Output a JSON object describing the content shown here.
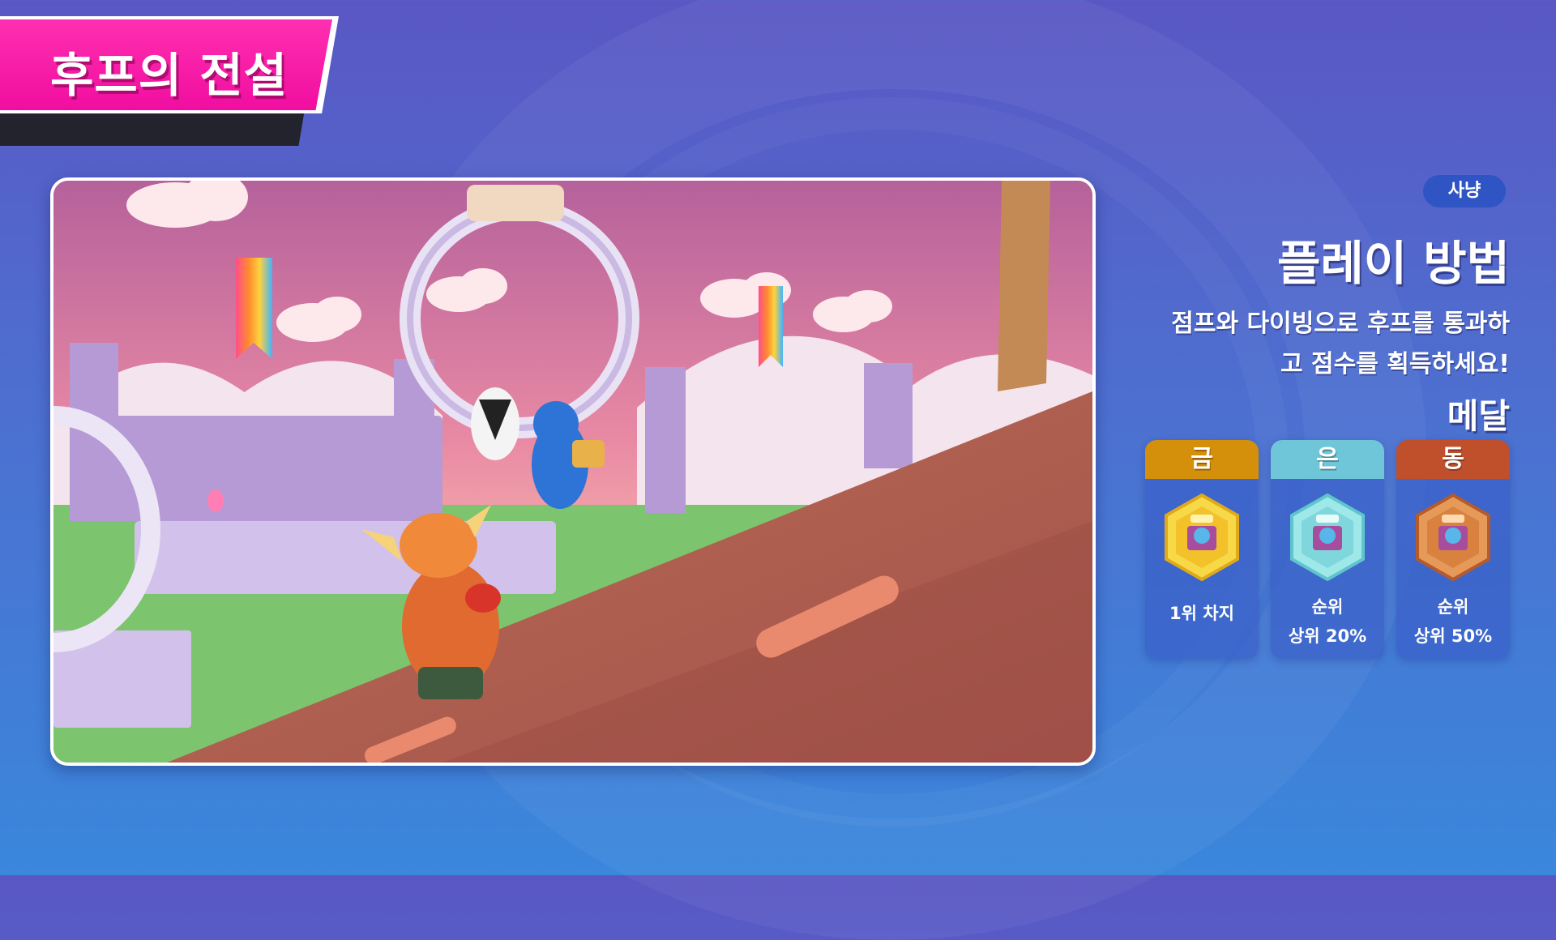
{
  "title": "후프의 전설",
  "panel": {
    "mode_badge": "사냥",
    "heading": "플레이 방법",
    "description_line1": "점프와 다이빙으로 후프를 통과하",
    "description_line2": "고 점수를 획득하세요!",
    "medal_heading": "메달"
  },
  "medals": [
    {
      "label": "금",
      "line1": "1위 차지",
      "line2": "",
      "color": "#d4900a",
      "icon": "gold-medal-icon"
    },
    {
      "label": "은",
      "line1": "순위",
      "line2": "상위 20%",
      "color": "#6ec6d8",
      "icon": "silver-medal-icon"
    },
    {
      "label": "동",
      "line1": "순위",
      "line2": "상위 50%",
      "color": "#c0502c",
      "icon": "bronze-medal-icon"
    }
  ],
  "colors": {
    "title_pink": "#f00ea0",
    "background_top": "#5a57c4",
    "background_bottom": "#3a87dc",
    "badge_blue": "#2f55c5"
  }
}
